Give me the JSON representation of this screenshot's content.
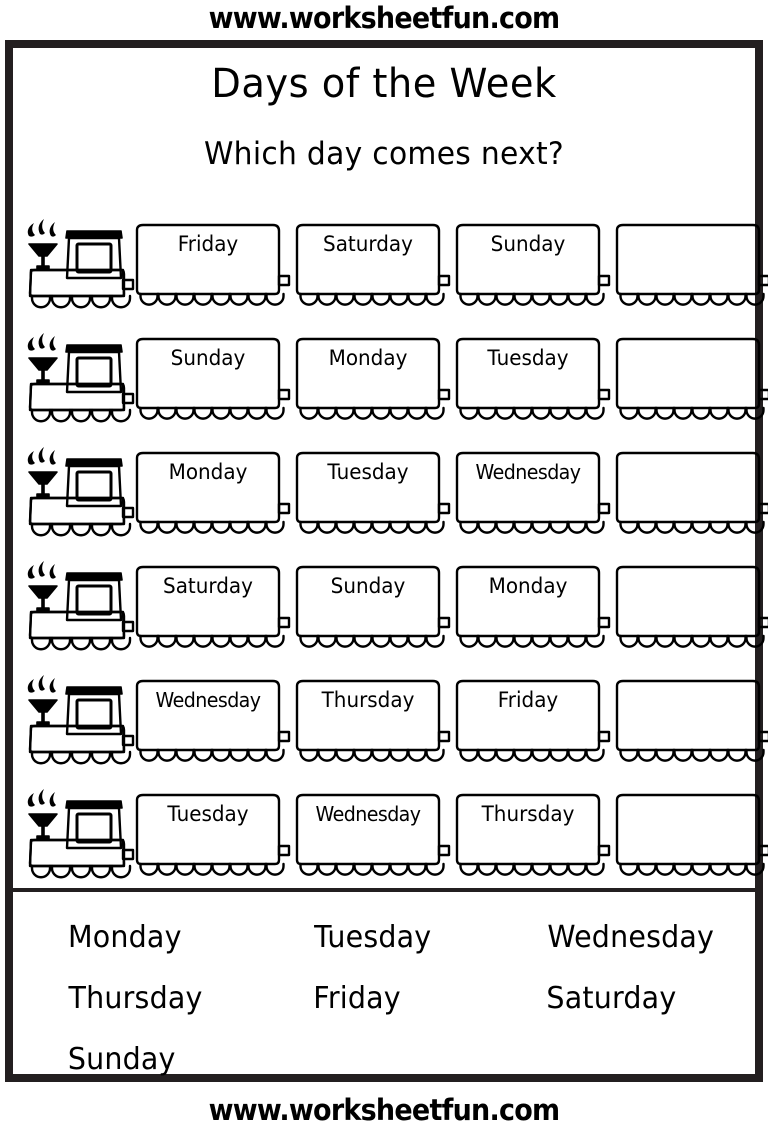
{
  "site": {
    "top_label": "www.worksheetfun.com",
    "bottom_label": "www.worksheetfun.com"
  },
  "header": {
    "title": "Days of the Week",
    "subtitle": "Which day comes next?"
  },
  "colors": {
    "ink": "#000000",
    "frame": "#231f20",
    "page": "#ffffff"
  },
  "icons": {
    "locomotive": "train-locomotive-icon",
    "smoke": "smoke-puff-icon",
    "wheel": "train-wheel-icon"
  },
  "rows": [
    {
      "cars": [
        "Friday",
        "Saturday",
        "Sunday",
        ""
      ]
    },
    {
      "cars": [
        "Sunday",
        "Monday",
        "Tuesday",
        ""
      ]
    },
    {
      "cars": [
        "Monday",
        "Tuesday",
        "Wednesday",
        ""
      ]
    },
    {
      "cars": [
        "Saturday",
        "Sunday",
        "Monday",
        ""
      ]
    },
    {
      "cars": [
        "Wednesday",
        "Thursday",
        "Friday",
        ""
      ]
    },
    {
      "cars": [
        "Tuesday",
        "Wednesday",
        "Thursday",
        ""
      ]
    }
  ],
  "word_bank": {
    "columns": 3,
    "words": [
      "Monday",
      "Tuesday",
      "Wednesday",
      "Thursday",
      "Friday",
      "Saturday",
      "Sunday"
    ]
  }
}
